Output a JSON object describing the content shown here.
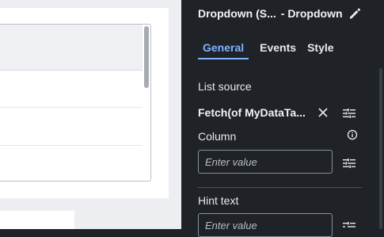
{
  "panel": {
    "title_component": "Dropdown (S...",
    "title_type": "- Dropdown",
    "tabs": [
      {
        "label": "General",
        "active": true
      },
      {
        "label": "Events",
        "active": false
      },
      {
        "label": "Style",
        "active": false
      }
    ],
    "list_source_label": "List source",
    "list_source_value": "Fetch(of MyDataTa...",
    "column_label": "Column",
    "column_placeholder": "Enter value",
    "hint_label": "Hint text",
    "hint_placeholder": "Enter value",
    "accent_color": "#7fb2ff",
    "icons": [
      "pencil-icon",
      "close-icon",
      "settings-icon",
      "info-icon"
    ]
  }
}
